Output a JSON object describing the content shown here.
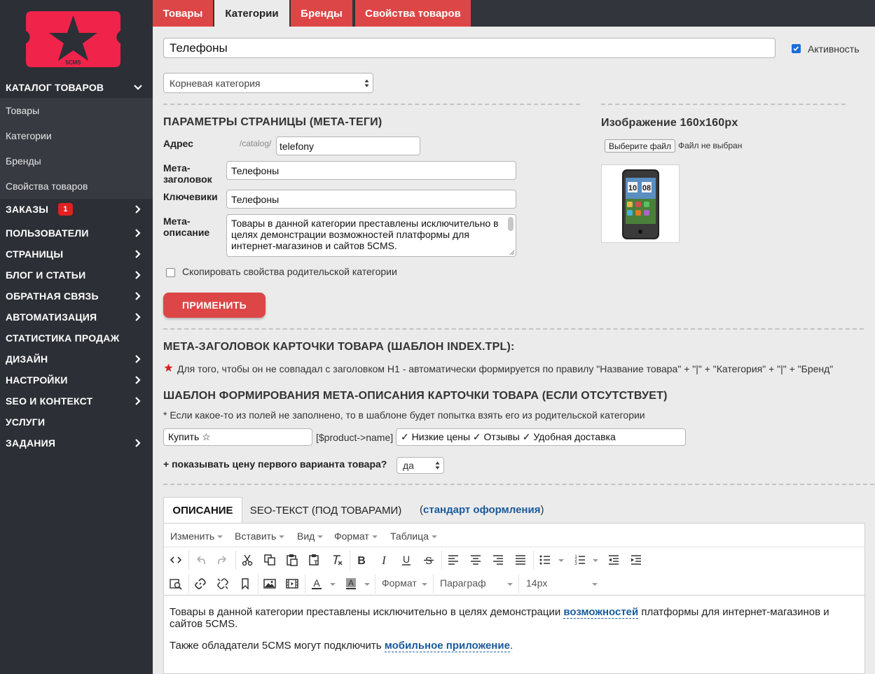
{
  "logo": {
    "text": "5CMS",
    "accent": "#f0234b"
  },
  "sidebar": {
    "catalog": "КАТАЛОГ ТОВАРОВ",
    "catalog_items": [
      "Товары",
      "Категории",
      "Бренды",
      "Свойства товаров"
    ],
    "orders": "ЗАКАЗЫ",
    "orders_badge": "1",
    "sections": [
      "ПОЛЬЗОВАТЕЛИ",
      "СТРАНИЦЫ",
      "БЛОГ И СТАТЬИ",
      "ОБРАТНАЯ СВЯЗЬ",
      "АВТОМАТИЗАЦИЯ",
      "СТАТИСТИКА ПРОДАЖ",
      "ДИЗАЙН",
      "НАСТРОЙКИ",
      "SEO И КОНТЕКСТ",
      "УСЛУГИ",
      "ЗАДАНИЯ"
    ]
  },
  "tabs": [
    "Товары",
    "Категории",
    "Бренды",
    "Свойства товаров"
  ],
  "form": {
    "name_value": "Телефоны",
    "active_label": "Активность",
    "parent_select": "Корневая категория",
    "meta_heading": "ПАРАМЕТРЫ СТРАНИЦЫ (МЕТА-ТЕГИ)",
    "address_label": "Адрес",
    "address_prefix": "/catalog/",
    "address_value": "telefony",
    "meta_title_label_1": "Мета-",
    "meta_title_label_2": "заголовок",
    "meta_title_value": "Телефоны",
    "keywords_label": "Ключевики",
    "keywords_value": "Телефоны",
    "meta_desc_label_1": "Мета-",
    "meta_desc_label_2": "описание",
    "meta_desc_value": "Товары в данной категории преставлены исключительно в целях демонстрации возможностей платформы для интернет-магазинов и сайтов 5CMS.",
    "copy_props_label": "Скопировать свойства родительской категории",
    "apply_button": "ПРИМЕНИТЬ"
  },
  "image": {
    "heading": "Изображение 160x160px",
    "choose_file": "Выберите файл",
    "no_file": "Файл не выбран",
    "phone_time_h": "10",
    "phone_time_m": "08"
  },
  "product_meta": {
    "heading": "МЕТА-ЗАГОЛОВОК КАРТОЧКИ ТОВАРА (ШАБЛОН INDEX.TPL):",
    "note": "Для того, чтобы он не совпадал с заголовком H1 - автоматически формируется по правилу \"Название товара\" + \"|\" + \"Категория\" + \"|\" + \"Бренд\"",
    "desc_heading": "ШАБЛОН ФОРМИРОВАНИЯ МЕТА-ОПИСАНИЯ КАРТОЧКИ ТОВАРА (ЕСЛИ ОТСУТСТВУЕТ)",
    "desc_note": "* Если какое-то из полей не заполнено, то в шаблоне будет попытка взять его из родительской категории",
    "prefix_value": "Купить ☆",
    "product_var": "[$product->name]",
    "suffix_value": "✓ Низкие цены ✓ Отзывы ✓ Удобная доставка",
    "show_price_label": "+ показывать цену первого варианта товара?",
    "show_price_value": "да"
  },
  "editor_tabs": {
    "description": "ОПИСАНИЕ",
    "seo_text": "SEO-ТЕКСТ (ПОД ТОВАРАМИ)",
    "standard_open": "(",
    "standard": "стандарт оформления",
    "standard_close": ")"
  },
  "editor": {
    "menu": [
      "Изменить",
      "Вставить",
      "Вид",
      "Формат",
      "Таблица"
    ],
    "format_dd": "Формат",
    "block_dd": "Параграф",
    "size_dd": "14px",
    "p1_a": "Товары в данной категории преставлены исключительно в целях демонстрации ",
    "p1_link": "возможностей",
    "p1_b": " платформы для интернет-магазинов и сайтов 5CMS.",
    "p2_a": "Также обладатели 5CMS могут подключить ",
    "p2_link": "мобильное приложение",
    "p2_b": "."
  }
}
